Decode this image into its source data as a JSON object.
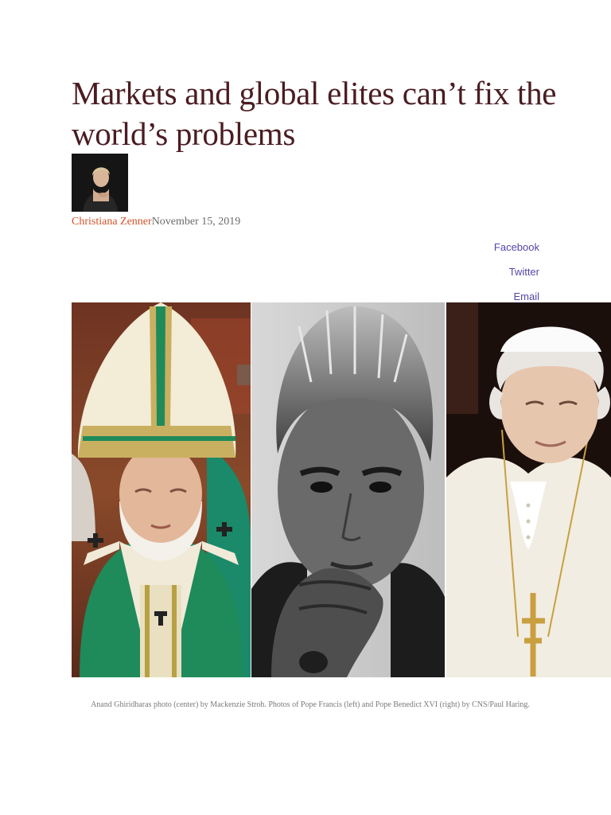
{
  "article": {
    "headline": "Markets and global elites can’t fix the world’s problems",
    "author": "Christiana Zenner",
    "date": "November 15, 2019"
  },
  "share": {
    "facebook": "Facebook",
    "twitter": "Twitter",
    "email": "Email"
  },
  "image": {
    "caption": "Anand Ghiridharas photo (center) by Mackenzie Stroh. Photos of Pope Francis (left) and Pope Benedict XVI (right) by CNS/Paul Haring."
  },
  "colors": {
    "headline": "#4a1c22",
    "author": "#d2522a",
    "date": "#6b6b6b",
    "share_link": "#5247a8",
    "caption": "#7a7a7a"
  }
}
